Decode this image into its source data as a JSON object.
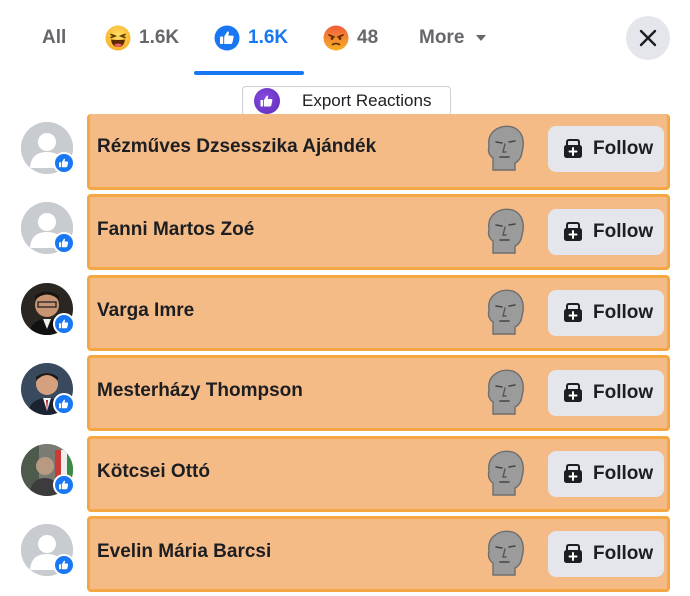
{
  "tabs": [
    {
      "label": "All",
      "count": "",
      "icon": "",
      "active": false
    },
    {
      "label": "",
      "count": "1.6K",
      "icon": "haha-reaction-icon",
      "active": false
    },
    {
      "label": "",
      "count": "1.6K",
      "icon": "like-reaction-icon",
      "active": true
    },
    {
      "label": "",
      "count": "48",
      "icon": "angry-reaction-icon",
      "active": false
    },
    {
      "label": "More",
      "count": "",
      "icon": "caret-down-icon",
      "active": false
    }
  ],
  "export": {
    "label": "Export Reactions"
  },
  "people": [
    {
      "name": "Rézműves Dzsesszika Ajándék",
      "avatar": "default",
      "follow_label": "Follow"
    },
    {
      "name": "Fanni Martos Zoé",
      "avatar": "default",
      "follow_label": "Follow"
    },
    {
      "name": "Varga Imre",
      "avatar": "photo",
      "follow_label": "Follow"
    },
    {
      "name": "Mesterházy Thompson",
      "avatar": "photo",
      "follow_label": "Follow"
    },
    {
      "name": "Kötcsei Ottó",
      "avatar": "photo",
      "follow_label": "Follow"
    },
    {
      "name": "Evelin Mária Barcsi",
      "avatar": "default",
      "follow_label": "Follow"
    }
  ],
  "colors": {
    "accent": "#1877f2",
    "card_fill": "#f5bb87",
    "card_border": "#f4a742",
    "button_bg": "#e4e6eb"
  }
}
